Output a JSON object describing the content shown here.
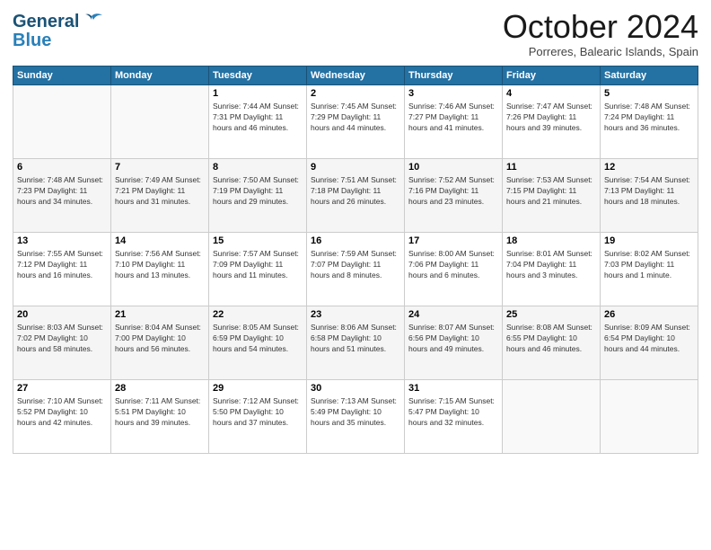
{
  "header": {
    "logo_line1": "General",
    "logo_line2": "Blue",
    "title": "October 2024",
    "location": "Porreres, Balearic Islands, Spain"
  },
  "weekdays": [
    "Sunday",
    "Monday",
    "Tuesday",
    "Wednesday",
    "Thursday",
    "Friday",
    "Saturday"
  ],
  "weeks": [
    [
      {
        "day": "",
        "info": ""
      },
      {
        "day": "",
        "info": ""
      },
      {
        "day": "1",
        "info": "Sunrise: 7:44 AM\nSunset: 7:31 PM\nDaylight: 11 hours and 46 minutes."
      },
      {
        "day": "2",
        "info": "Sunrise: 7:45 AM\nSunset: 7:29 PM\nDaylight: 11 hours and 44 minutes."
      },
      {
        "day": "3",
        "info": "Sunrise: 7:46 AM\nSunset: 7:27 PM\nDaylight: 11 hours and 41 minutes."
      },
      {
        "day": "4",
        "info": "Sunrise: 7:47 AM\nSunset: 7:26 PM\nDaylight: 11 hours and 39 minutes."
      },
      {
        "day": "5",
        "info": "Sunrise: 7:48 AM\nSunset: 7:24 PM\nDaylight: 11 hours and 36 minutes."
      }
    ],
    [
      {
        "day": "6",
        "info": "Sunrise: 7:48 AM\nSunset: 7:23 PM\nDaylight: 11 hours and 34 minutes."
      },
      {
        "day": "7",
        "info": "Sunrise: 7:49 AM\nSunset: 7:21 PM\nDaylight: 11 hours and 31 minutes."
      },
      {
        "day": "8",
        "info": "Sunrise: 7:50 AM\nSunset: 7:19 PM\nDaylight: 11 hours and 29 minutes."
      },
      {
        "day": "9",
        "info": "Sunrise: 7:51 AM\nSunset: 7:18 PM\nDaylight: 11 hours and 26 minutes."
      },
      {
        "day": "10",
        "info": "Sunrise: 7:52 AM\nSunset: 7:16 PM\nDaylight: 11 hours and 23 minutes."
      },
      {
        "day": "11",
        "info": "Sunrise: 7:53 AM\nSunset: 7:15 PM\nDaylight: 11 hours and 21 minutes."
      },
      {
        "day": "12",
        "info": "Sunrise: 7:54 AM\nSunset: 7:13 PM\nDaylight: 11 hours and 18 minutes."
      }
    ],
    [
      {
        "day": "13",
        "info": "Sunrise: 7:55 AM\nSunset: 7:12 PM\nDaylight: 11 hours and 16 minutes."
      },
      {
        "day": "14",
        "info": "Sunrise: 7:56 AM\nSunset: 7:10 PM\nDaylight: 11 hours and 13 minutes."
      },
      {
        "day": "15",
        "info": "Sunrise: 7:57 AM\nSunset: 7:09 PM\nDaylight: 11 hours and 11 minutes."
      },
      {
        "day": "16",
        "info": "Sunrise: 7:59 AM\nSunset: 7:07 PM\nDaylight: 11 hours and 8 minutes."
      },
      {
        "day": "17",
        "info": "Sunrise: 8:00 AM\nSunset: 7:06 PM\nDaylight: 11 hours and 6 minutes."
      },
      {
        "day": "18",
        "info": "Sunrise: 8:01 AM\nSunset: 7:04 PM\nDaylight: 11 hours and 3 minutes."
      },
      {
        "day": "19",
        "info": "Sunrise: 8:02 AM\nSunset: 7:03 PM\nDaylight: 11 hours and 1 minute."
      }
    ],
    [
      {
        "day": "20",
        "info": "Sunrise: 8:03 AM\nSunset: 7:02 PM\nDaylight: 10 hours and 58 minutes."
      },
      {
        "day": "21",
        "info": "Sunrise: 8:04 AM\nSunset: 7:00 PM\nDaylight: 10 hours and 56 minutes."
      },
      {
        "day": "22",
        "info": "Sunrise: 8:05 AM\nSunset: 6:59 PM\nDaylight: 10 hours and 54 minutes."
      },
      {
        "day": "23",
        "info": "Sunrise: 8:06 AM\nSunset: 6:58 PM\nDaylight: 10 hours and 51 minutes."
      },
      {
        "day": "24",
        "info": "Sunrise: 8:07 AM\nSunset: 6:56 PM\nDaylight: 10 hours and 49 minutes."
      },
      {
        "day": "25",
        "info": "Sunrise: 8:08 AM\nSunset: 6:55 PM\nDaylight: 10 hours and 46 minutes."
      },
      {
        "day": "26",
        "info": "Sunrise: 8:09 AM\nSunset: 6:54 PM\nDaylight: 10 hours and 44 minutes."
      }
    ],
    [
      {
        "day": "27",
        "info": "Sunrise: 7:10 AM\nSunset: 5:52 PM\nDaylight: 10 hours and 42 minutes."
      },
      {
        "day": "28",
        "info": "Sunrise: 7:11 AM\nSunset: 5:51 PM\nDaylight: 10 hours and 39 minutes."
      },
      {
        "day": "29",
        "info": "Sunrise: 7:12 AM\nSunset: 5:50 PM\nDaylight: 10 hours and 37 minutes."
      },
      {
        "day": "30",
        "info": "Sunrise: 7:13 AM\nSunset: 5:49 PM\nDaylight: 10 hours and 35 minutes."
      },
      {
        "day": "31",
        "info": "Sunrise: 7:15 AM\nSunset: 5:47 PM\nDaylight: 10 hours and 32 minutes."
      },
      {
        "day": "",
        "info": ""
      },
      {
        "day": "",
        "info": ""
      }
    ]
  ]
}
